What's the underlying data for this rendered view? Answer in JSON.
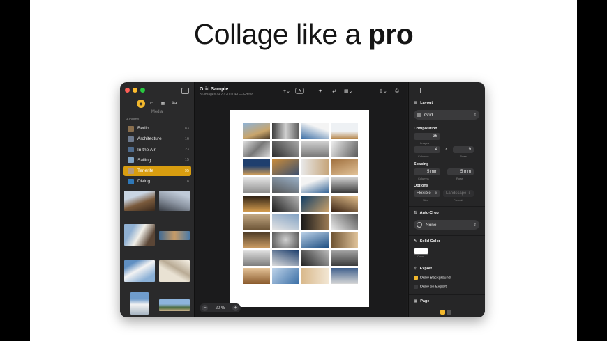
{
  "headline": {
    "prefix": "Collage like a",
    "bold": "pro"
  },
  "sidebar": {
    "caption": "Media",
    "albums_heading": "Albums",
    "albums": [
      {
        "name": "Berlin",
        "count": "83",
        "selected": false,
        "color": "#8a6f4e"
      },
      {
        "name": "Architecture",
        "count": "16",
        "selected": false,
        "color": "#6e7b8f"
      },
      {
        "name": "In the Air",
        "count": "23",
        "selected": false,
        "color": "#4f6c8e"
      },
      {
        "name": "Sailing",
        "count": "15",
        "selected": false,
        "color": "#7fa3c4"
      },
      {
        "name": "Tenerife",
        "count": "95",
        "selected": true,
        "color": "#b59a7a"
      },
      {
        "name": "Diving",
        "count": "18",
        "selected": false,
        "color": "#2f78b8"
      }
    ]
  },
  "document": {
    "title": "Grid Sample",
    "subtitle": "36 images / A2 / 200 DPI — Edited",
    "zoom": "20 %"
  },
  "inspector": {
    "layout_heading": "Layout",
    "layout_value": "Grid",
    "composition_heading": "Composition",
    "images_value": "36",
    "images_label": "Images",
    "columns_value": "4",
    "rows_value": "9",
    "columns_label": "Columns",
    "rows_label": "Rows",
    "times": "×",
    "spacing_heading": "Spacing",
    "spacing_columns": "5 mm",
    "spacing_rows": "5 mm",
    "spacing_columns_label": "Columns",
    "spacing_rows_label": "Rows",
    "options_heading": "Options",
    "size_value": "Flexible",
    "format_value": "Landscape",
    "size_label": "Size",
    "format_label": "Format",
    "autocrop_heading": "Auto-Crop",
    "autocrop_value": "None",
    "solid_color_heading": "Solid Color",
    "color_label": "Color",
    "export_heading": "Export",
    "draw_background": "Draw Background",
    "draw_on_export": "Draw on Export",
    "page_heading": "Page"
  },
  "colors": {
    "accent": "#f2b82d",
    "window_bg": "#1e1e1f"
  }
}
